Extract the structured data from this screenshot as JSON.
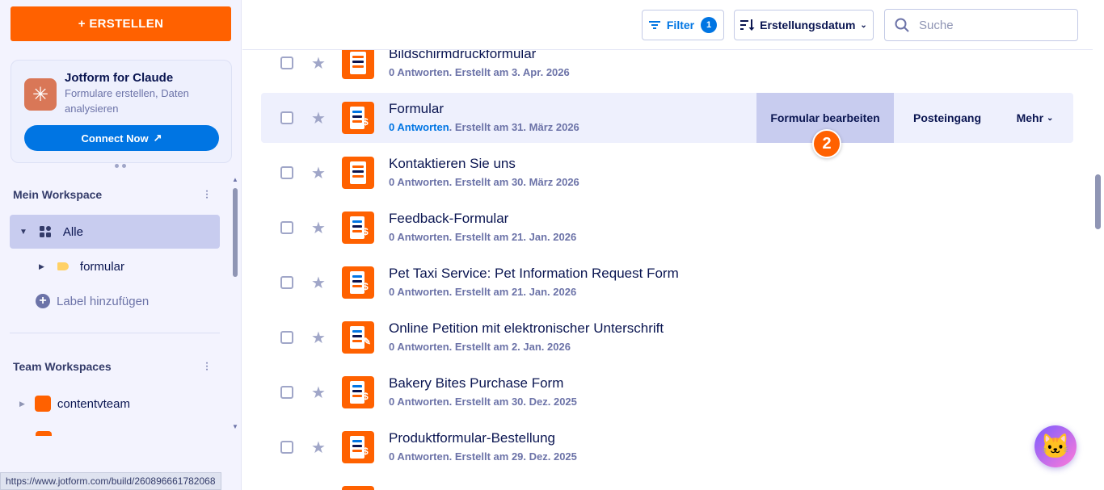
{
  "sidebar": {
    "create_label": "+ ERSTELLEN",
    "promo": {
      "title": "Jotform for Claude",
      "subtitle": "Formulare erstellen, Daten analysieren",
      "button": "Connect Now",
      "button_icon": "↗"
    },
    "my_workspace": {
      "title": "Mein Workspace",
      "all_label": "Alle",
      "folder_label": "formular",
      "add_label": "Label hinzufügen"
    },
    "team_workspaces": {
      "title": "Team Workspaces",
      "items": [
        "contentvteam"
      ]
    },
    "status_url": "https://www.jotform.com/build/260896661782068"
  },
  "toolbar": {
    "filter_label": "Filter",
    "filter_count": "1",
    "sort_label": "Erstellungsdatum",
    "search_placeholder": "Suche"
  },
  "forms": [
    {
      "name": "Bildschirmdruckformular",
      "answers": "0 Antworten",
      "created": ". Erstellt am 3. Apr. 2026",
      "icon": "form"
    },
    {
      "name": "Formular",
      "answers": "0 Antworten",
      "created": ". Erstellt am 31. März 2026",
      "icon": "payment"
    },
    {
      "name": "Kontaktieren Sie uns",
      "answers": "0 Antworten",
      "created": ". Erstellt am 30. März 2026",
      "icon": "form"
    },
    {
      "name": "Feedback-Formular",
      "answers": "0 Antworten",
      "created": ". Erstellt am 21. Jan. 2026",
      "icon": "payment"
    },
    {
      "name": "Pet Taxi Service: Pet Information Request Form",
      "answers": "0 Antworten",
      "created": ". Erstellt am 21. Jan. 2026",
      "icon": "payment"
    },
    {
      "name": "Online Petition mit elektronischer Unterschrift",
      "answers": "0 Antworten",
      "created": ". Erstellt am 2. Jan. 2026",
      "icon": "signature"
    },
    {
      "name": "Bakery Bites Purchase Form",
      "answers": "0 Antworten",
      "created": ". Erstellt am 30. Dez. 2025",
      "icon": "payment"
    },
    {
      "name": "Produktformular-Bestellung",
      "answers": "0 Antworten",
      "created": ". Erstellt am 29. Dez. 2025",
      "icon": "payment"
    }
  ],
  "active_row": {
    "edit_label": "Formular bearbeiten",
    "inbox_label": "Posteingang",
    "more_label": "Mehr"
  },
  "step_badge": "2"
}
